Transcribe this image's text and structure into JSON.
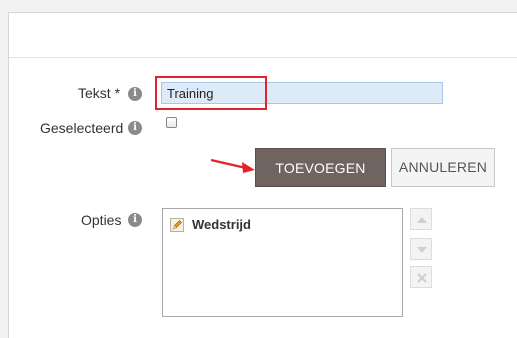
{
  "form": {
    "tekst_label": "Tekst *",
    "tekst_value": "Training",
    "geselecteerd_label": "Geselecteerd",
    "opties_label": "Opties",
    "info_glyph": "i"
  },
  "buttons": {
    "add_label": "TOEVOEGEN",
    "cancel_label": "ANNULEREN"
  },
  "options": {
    "items": [
      {
        "label": "Wedstrijd",
        "icon": "pencil-icon"
      }
    ]
  },
  "colors": {
    "highlight": "#e0242a",
    "add_button_bg": "#6f6460",
    "input_bg": "#ddeaf8"
  }
}
